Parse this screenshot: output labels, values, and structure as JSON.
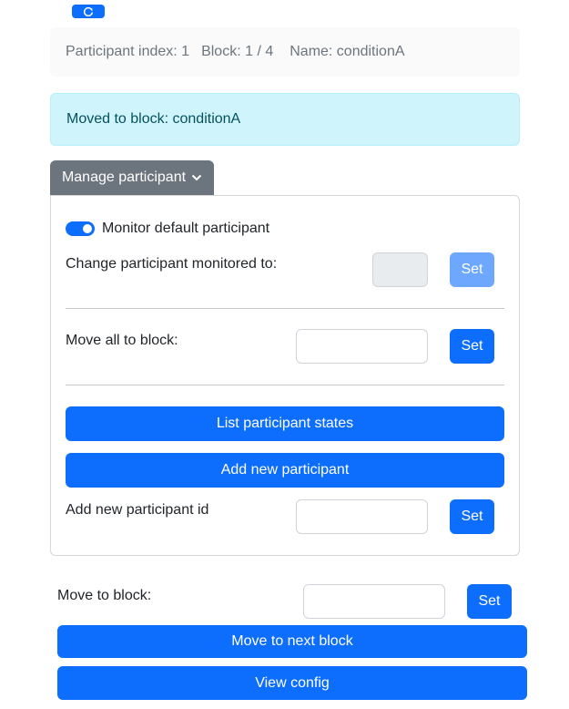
{
  "header": {
    "refresh_icon": "refresh-icon"
  },
  "info": {
    "participant_index": "Participant index: 1",
    "block": "Block: 1 / 4",
    "name": "Name: conditionA"
  },
  "alert": {
    "message": "Moved to block: conditionA"
  },
  "manage": {
    "toggle_label": "Manage participant",
    "monitor_default_label": "Monitor default participant",
    "monitor_default_on": true,
    "change_monitored_label": "Change participant monitored to:",
    "change_monitored_set": "Set",
    "move_all_label": "Move all to block:",
    "move_all_set": "Set",
    "list_states_button": "List participant states",
    "add_participant_button": "Add new participant",
    "add_participant_id_label": "Add new participant id",
    "add_participant_id_set": "Set"
  },
  "move_block": {
    "label": "Move to block:",
    "set": "Set",
    "next_button": "Move to next block",
    "view_config_button": "View config"
  },
  "colors": {
    "primary": "#0d6efd",
    "secondary": "#6c757d",
    "info_bg": "#cff4fc",
    "info_text": "#055160"
  }
}
